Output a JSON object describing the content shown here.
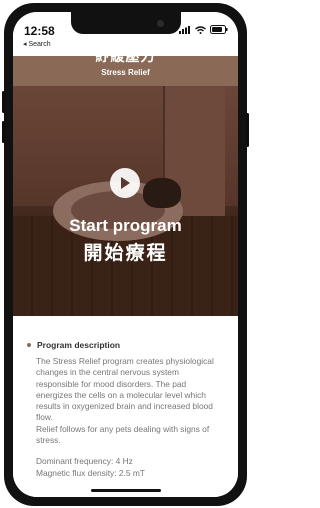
{
  "status_bar": {
    "time": "12:58",
    "back_label": "◂ Search"
  },
  "header": {
    "title_zh": "紓緩壓力",
    "title_en": "Stress Relief"
  },
  "hero": {
    "start_en": "Start program",
    "start_zh": "開始療程"
  },
  "description": {
    "heading": "Program description",
    "body": "The Stress Relief program creates physiological changes in the central nervous system responsible for mood disorders. The pad energizes the cells on a molecular level which results in oxygenized brain and increased blood flow.",
    "followup": "Relief follows for any pets dealing with signs of stress."
  },
  "specs": [
    "Dominant frequency: 4 Hz",
    "Magnetic flux density: 2.5 mT"
  ],
  "colors": {
    "header_bg": "#8a6a57",
    "accent": "#8a6a57"
  }
}
